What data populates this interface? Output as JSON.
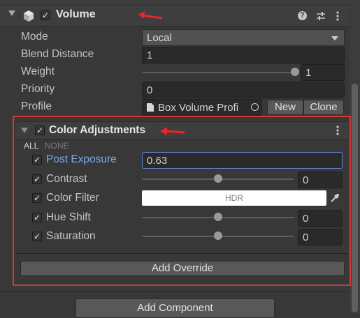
{
  "volume": {
    "title": "Volume",
    "fields": {
      "mode_label": "Mode",
      "mode_value": "Local",
      "blend_label": "Blend Distance",
      "blend_value": "1",
      "weight_label": "Weight",
      "weight_value": "1",
      "weight_slider_fraction": 1.0,
      "priority_label": "Priority",
      "priority_value": "0",
      "profile_label": "Profile",
      "profile_value": "Box Volume Profi",
      "new_label": "New",
      "clone_label": "Clone"
    }
  },
  "color_adjustments": {
    "title": "Color Adjustments",
    "all_label": "ALL",
    "none_label": "NONE",
    "post_exposure_label": "Post Exposure",
    "post_exposure_value": "0.63",
    "contrast_label": "Contrast",
    "contrast_value": "0",
    "contrast_fraction": 0.5,
    "color_filter_label": "Color Filter",
    "color_filter_badge": "HDR",
    "color_filter_color": "#ffffff",
    "hue_shift_label": "Hue Shift",
    "hue_shift_value": "0",
    "hue_shift_fraction": 0.5,
    "saturation_label": "Saturation",
    "saturation_value": "0",
    "saturation_fraction": 0.5,
    "add_override_label": "Add Override"
  },
  "footer": {
    "add_component_label": "Add Component"
  },
  "colors": {
    "highlight_outline": "#d23a3a",
    "annotation_arrow": "#e8262b",
    "label_blue": "#7aa7f0"
  }
}
